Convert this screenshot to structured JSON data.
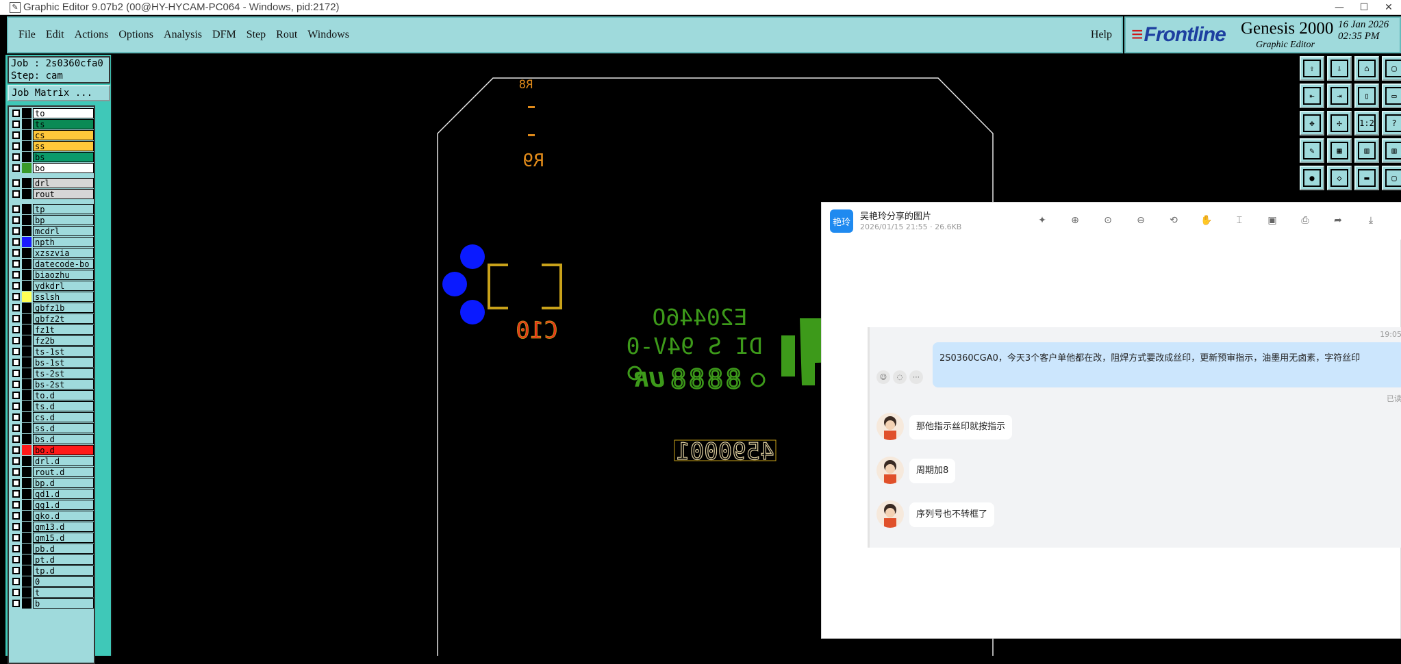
{
  "window": {
    "title": "Graphic Editor 9.07b2 (00@HY-HYCAM-PC064 - Windows, pid:2172)",
    "controls": [
      "—",
      "☐",
      "✕"
    ]
  },
  "menubar": {
    "items": [
      "File",
      "Edit",
      "Actions",
      "Options",
      "Analysis",
      "DFM",
      "Step",
      "Rout",
      "Windows"
    ],
    "help": "Help"
  },
  "brand": {
    "logo": "Frontline",
    "product": "Genesis 2000",
    "subtitle": "Graphic Editor",
    "date": "16 Jan 2026",
    "time": "02:35 PM"
  },
  "job": {
    "job_line": "Job : 2s0360cfa0",
    "step_line": "Step: cam",
    "matrix_button": "Job Matrix ..."
  },
  "layers": [
    {
      "name": "to",
      "color": "#ffffff",
      "swatch": "#000000"
    },
    {
      "name": "ts",
      "color": "#0b8a55",
      "swatch": "#000000"
    },
    {
      "name": "cs",
      "color": "#ffc83a",
      "swatch": "#000000"
    },
    {
      "name": "ss",
      "color": "#ffc83a",
      "swatch": "#000000"
    },
    {
      "name": "bs",
      "color": "#0b9a6a",
      "swatch": "#000000"
    },
    {
      "name": "bo",
      "color": "#ffffff",
      "swatch": "#3a9a2a"
    },
    {
      "name": "drl",
      "color": "#d6d6d6",
      "swatch": "#000000"
    },
    {
      "name": "rout",
      "color": "#d6d6d6",
      "swatch": "#000000"
    },
    {
      "name": "tp",
      "color": "#9fdadc",
      "swatch": "#000000"
    },
    {
      "name": "bp",
      "color": "#9fdadc",
      "swatch": "#000000"
    },
    {
      "name": "mcdrl",
      "color": "#9fdadc",
      "swatch": "#000000"
    },
    {
      "name": "npth",
      "color": "#9fdadc",
      "swatch": "#1a1aff"
    },
    {
      "name": "xzszvia",
      "color": "#9fdadc",
      "swatch": "#000000"
    },
    {
      "name": "datecode-bo",
      "color": "#9fdadc",
      "swatch": "#000000"
    },
    {
      "name": "biaozhu",
      "color": "#9fdadc",
      "swatch": "#000000"
    },
    {
      "name": "ydkdrl",
      "color": "#9fdadc",
      "swatch": "#000000"
    },
    {
      "name": "sslsh",
      "color": "#9fdadc",
      "swatch": "#ffff55"
    },
    {
      "name": "gbfz1b",
      "color": "#9fdadc",
      "swatch": "#000000"
    },
    {
      "name": "gbfz2t",
      "color": "#9fdadc",
      "swatch": "#000000"
    },
    {
      "name": "fz1t",
      "color": "#9fdadc",
      "swatch": "#000000"
    },
    {
      "name": "fz2b",
      "color": "#9fdadc",
      "swatch": "#000000"
    },
    {
      "name": "ts-1st",
      "color": "#9fdadc",
      "swatch": "#000000"
    },
    {
      "name": "bs-1st",
      "color": "#9fdadc",
      "swatch": "#000000"
    },
    {
      "name": "ts-2st",
      "color": "#9fdadc",
      "swatch": "#000000"
    },
    {
      "name": "bs-2st",
      "color": "#9fdadc",
      "swatch": "#000000"
    },
    {
      "name": "to.d",
      "color": "#9fdadc",
      "swatch": "#000000"
    },
    {
      "name": "ts.d",
      "color": "#9fdadc",
      "swatch": "#000000"
    },
    {
      "name": "cs.d",
      "color": "#9fdadc",
      "swatch": "#000000"
    },
    {
      "name": "ss.d",
      "color": "#9fdadc",
      "swatch": "#000000"
    },
    {
      "name": "bs.d",
      "color": "#9fdadc",
      "swatch": "#000000"
    },
    {
      "name": "bo.d",
      "color": "#ff1a1a",
      "swatch": "#ff1a1a"
    },
    {
      "name": "drl.d",
      "color": "#9fdadc",
      "swatch": "#000000"
    },
    {
      "name": "rout.d",
      "color": "#9fdadc",
      "swatch": "#000000"
    },
    {
      "name": "bp.d",
      "color": "#9fdadc",
      "swatch": "#000000"
    },
    {
      "name": "qd1.d",
      "color": "#9fdadc",
      "swatch": "#000000"
    },
    {
      "name": "qg1.d",
      "color": "#9fdadc",
      "swatch": "#000000"
    },
    {
      "name": "qko.d",
      "color": "#9fdadc",
      "swatch": "#000000"
    },
    {
      "name": "gm13.d",
      "color": "#9fdadc",
      "swatch": "#000000"
    },
    {
      "name": "gm15.d",
      "color": "#9fdadc",
      "swatch": "#000000"
    },
    {
      "name": "pb.d",
      "color": "#9fdadc",
      "swatch": "#000000"
    },
    {
      "name": "pt.d",
      "color": "#9fdadc",
      "swatch": "#000000"
    },
    {
      "name": "tp.d",
      "color": "#9fdadc",
      "swatch": "#000000"
    },
    {
      "name": "0",
      "color": "#9fdadc",
      "swatch": "#000000"
    },
    {
      "name": "t",
      "color": "#9fdadc",
      "swatch": "#000000"
    },
    {
      "name": "b",
      "color": "#9fdadc",
      "swatch": "#000000"
    }
  ],
  "board": {
    "ref_r8": "R8",
    "ref_r9": "R9",
    "ref_c10": "C10",
    "code_line1": "E20446O",
    "code_line2": "DI S 94V-0",
    "ul_mark": "UR",
    "date_digits": "8888",
    "serial": "4590001",
    "colors": {
      "outline": "#e6e6e6",
      "silk_orange": "#e08a1a",
      "silk_green": "#3d9a1a",
      "pads": "#0a1aff",
      "frame": "#c9a21a",
      "c10": "#e8321a",
      "serial": "#e0d0a0"
    }
  },
  "viewer": {
    "badge": "艳玲",
    "title": "吴艳玲分享的图片",
    "meta": "2026/01/15 21:55 · 26.6KB",
    "tools": [
      "magic-wand-icon",
      "zoom-in-icon",
      "original-size-icon",
      "zoom-out-icon",
      "rotate-icon",
      "hand-icon",
      "ocr-icon",
      "fit-icon",
      "print-icon",
      "share-icon",
      "download-icon"
    ],
    "chat": {
      "time": "19:05",
      "my_message": "2S0360CGA0，今天3个客户单他都在改，阻焊方式要改成丝印，更新预审指示，油墨用无卤素，字符丝印",
      "read_mark": "已读",
      "replies": [
        "那他指示丝印就按指示",
        "周期加8",
        "序列号也不转框了"
      ]
    }
  }
}
